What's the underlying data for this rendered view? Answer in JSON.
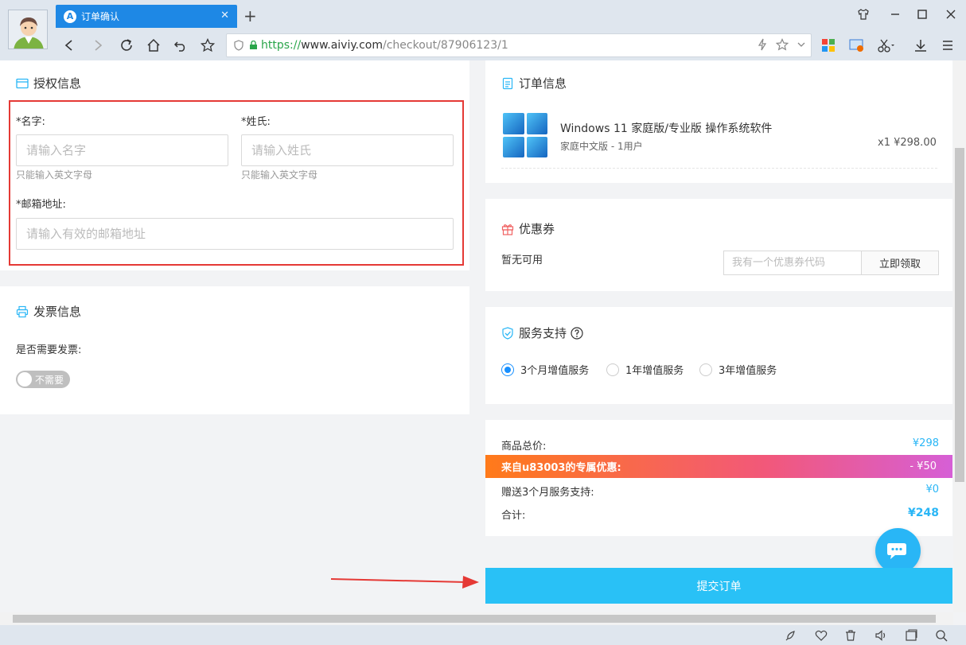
{
  "browser": {
    "tab_title": "订单确认",
    "tab_logo": "A",
    "url_scheme": "https://",
    "url_host": "www.aiviy.com",
    "url_path": "/checkout/87906123/1"
  },
  "auth": {
    "title": "授权信息",
    "first_name_label": "*名字:",
    "first_name_placeholder": "请输入名字",
    "first_name_hint": "只能输入英文字母",
    "last_name_label": "*姓氏:",
    "last_name_placeholder": "请输入姓氏",
    "last_name_hint": "只能输入英文字母",
    "email_label": "*邮箱地址:",
    "email_placeholder": "请输入有效的邮箱地址"
  },
  "invoice": {
    "title": "发票信息",
    "question": "是否需要发票:",
    "toggle_label": "不需要",
    "toggle_on": false
  },
  "order": {
    "title": "订单信息",
    "product_name": "Windows 11 家庭版/专业版 操作系统软件",
    "product_variant": "家庭中文版 - 1用户",
    "qty_price": "x1 ¥298.00"
  },
  "coupon": {
    "title": "优惠券",
    "status": "暂无可用",
    "input_placeholder": "我有一个优惠券代码",
    "button": "立即领取"
  },
  "service": {
    "title": "服务支持",
    "options": [
      "3个月增值服务",
      "1年增值服务",
      "3年增值服务"
    ],
    "selected": 0
  },
  "summary": {
    "subtotal_label": "商品总价:",
    "subtotal_value": "¥298",
    "promo_label": "来自u83003的专属优惠:",
    "promo_value": "- ¥50",
    "gift_label": "赠送3个月服务支持:",
    "gift_value": "¥0",
    "total_label": "合计:",
    "total_value": "¥248"
  },
  "submit_label": "提交订单",
  "colors": {
    "accent": "#29c1f6",
    "tab_blue": "#1e88e5",
    "highlight_red": "#e53935",
    "promo_start": "#ff7a1a",
    "promo_end": "#d65fd6"
  }
}
